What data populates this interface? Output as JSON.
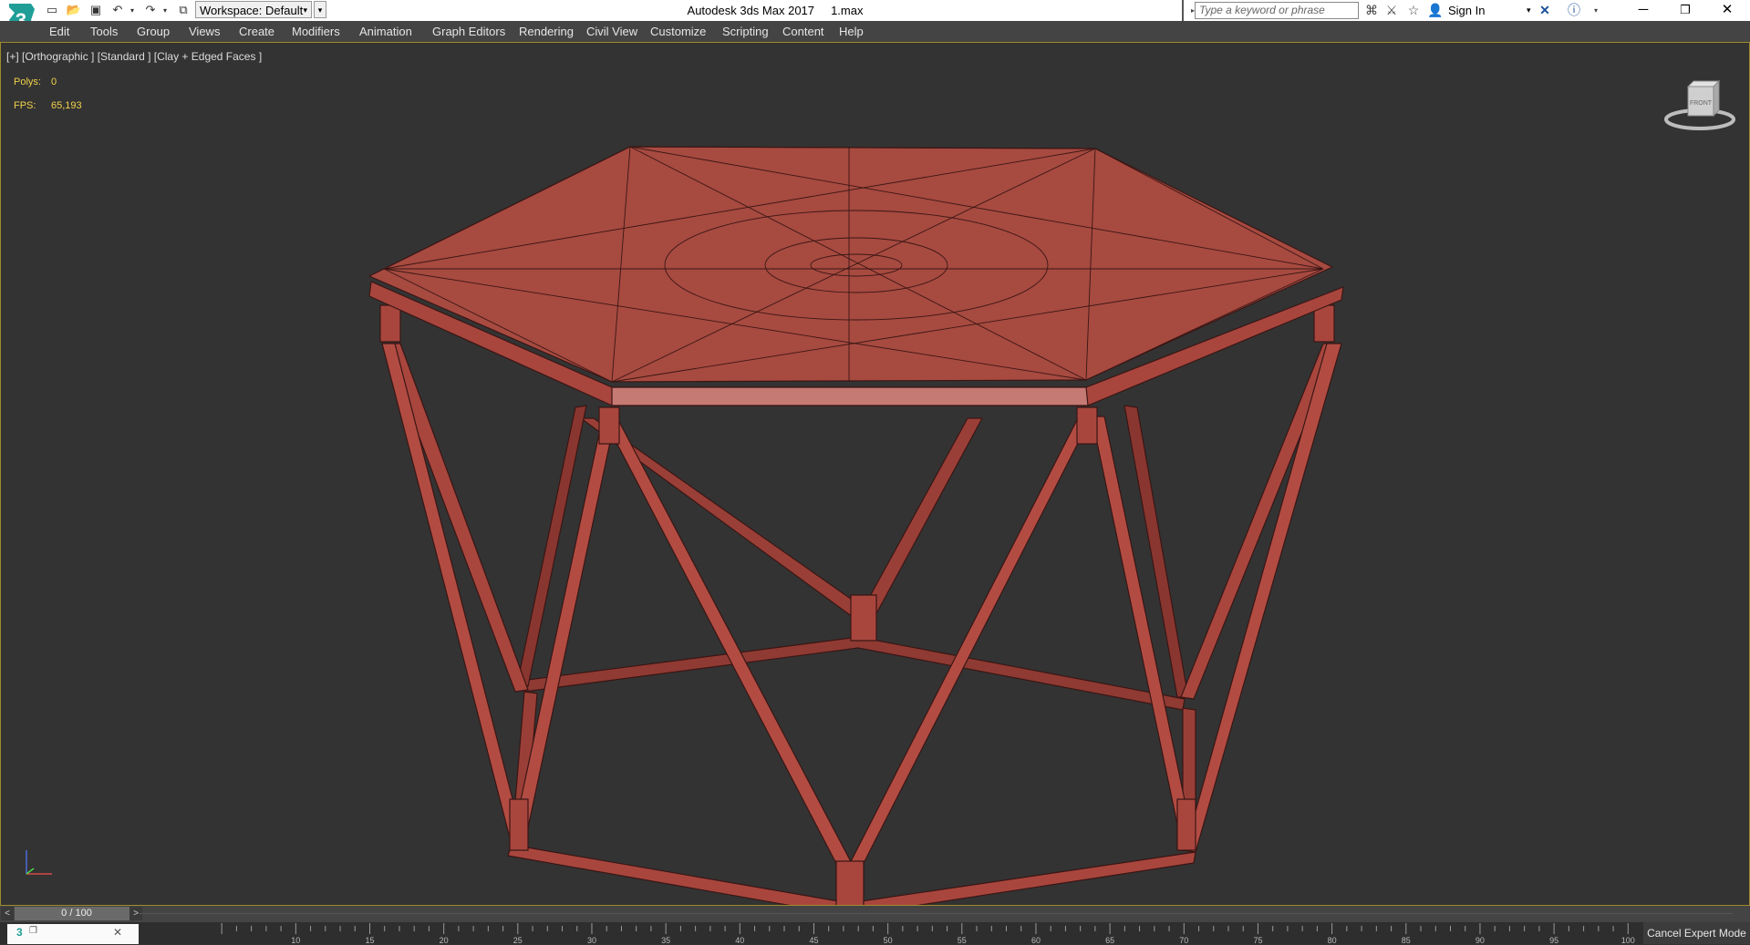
{
  "titlebar": {
    "workspace_label": "Workspace: Default",
    "window_title": "Autodesk 3ds Max 2017     1.max",
    "search_placeholder": "Type a keyword or phrase",
    "sign_in_label": "Sign In"
  },
  "menu": {
    "items": [
      "Edit",
      "Tools",
      "Group",
      "Views",
      "Create",
      "Modifiers",
      "Animation",
      "Graph Editors",
      "Rendering",
      "Civil View",
      "Customize",
      "Scripting",
      "Content",
      "Help"
    ]
  },
  "viewport": {
    "label": "[+] [Orthographic ] [Standard ] [Clay + Edged Faces ]",
    "stats": {
      "polys_label": "Polys:",
      "polys_value": "0",
      "fps_label": "FPS:",
      "fps_value": "65,193"
    },
    "viewcube_label": "FRONT",
    "model_color": "#a8463e",
    "edge_color": "#3a1614"
  },
  "timeline": {
    "frame_display": "0 / 100",
    "ticks": [
      "10",
      "15",
      "20",
      "25",
      "30",
      "35",
      "40",
      "45",
      "50",
      "55",
      "60",
      "65",
      "70",
      "75",
      "80",
      "85",
      "90",
      "95",
      "100"
    ]
  },
  "status": {
    "cancel_expert_label": "Cancel Expert Mode"
  },
  "colors": {
    "ui_dark": "#444444",
    "viewport_bg": "#333333",
    "viewport_border": "#a08a2c",
    "stat_text": "#f2d24a",
    "logo_teal": "#1f9e97"
  }
}
